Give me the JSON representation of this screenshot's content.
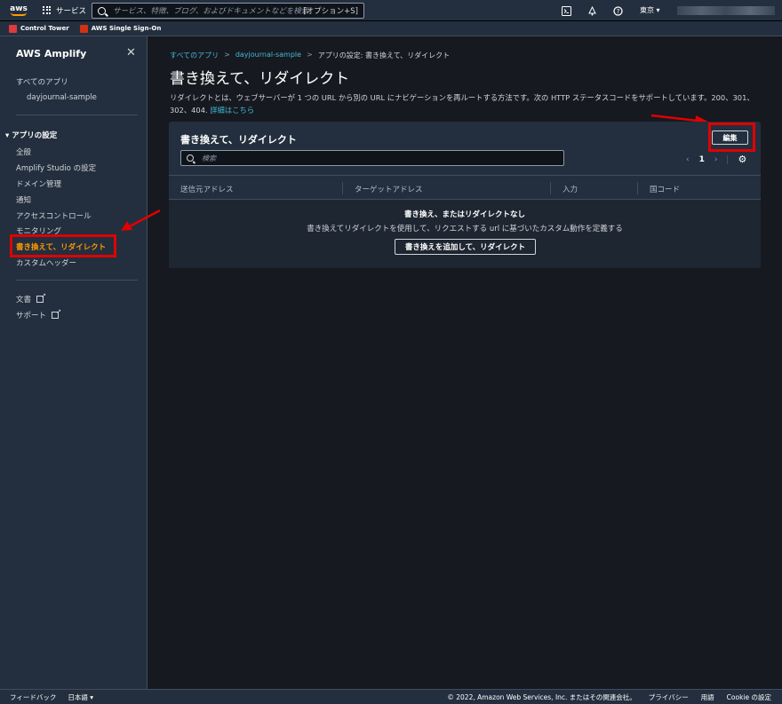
{
  "topnav": {
    "logo_text": "aws",
    "services_label": "サービス",
    "search_placeholder": "サービス、特徴、ブログ、およびドキュメントなどを検索",
    "search_shortcut": "[オプション+S]",
    "region": "東京 ▾",
    "icons": [
      "terminal-icon",
      "bell-icon",
      "help-icon"
    ]
  },
  "favorites": [
    {
      "label": "Control Tower",
      "color": "#e0393e"
    },
    {
      "label": "AWS Single Sign-On",
      "color": "#d13212"
    }
  ],
  "sidebar": {
    "title": "AWS Amplify",
    "close": "✕",
    "all_apps": "すべてのアプリ",
    "app_name": "dayjournal-sample",
    "section_title": "▾ アプリの設定",
    "items": [
      "全般",
      "Amplify Studio の設定",
      "ドメイン管理",
      "通知",
      "アクセスコントロール",
      "モニタリング",
      "書き換えて、リダイレクト",
      "カスタムヘッダー"
    ],
    "active_item": "書き換えて、リダイレクト",
    "links": [
      "文書",
      "サポート"
    ]
  },
  "breadcrumb": {
    "all_apps": "すべてのアプリ",
    "app": "dayjournal-sample",
    "current": "アプリの設定: 書き換えて、リダイレクト",
    "sep": ">"
  },
  "page": {
    "title": "書き換えて、リダイレクト",
    "description_line1": "リダイレクトとは、ウェブサーバーが 1 つの URL から別の URL にナビゲーションを再ルートする方法です。次の HTTP ステータスコードをサポートしています。200、301、",
    "description_line2": "302、404. ",
    "description_link": "詳細はこちら"
  },
  "panel": {
    "title": "書き換えて、リダイレクト",
    "edit_label": "編集",
    "filter_placeholder": "検索",
    "pager": {
      "prev": "‹",
      "page": "1",
      "next": "›",
      "settings": "⚙"
    },
    "columns": [
      "送信元アドレス",
      "ターゲットアドレス",
      "入力",
      "国コード"
    ],
    "empty_title": "書き換え、またはリダイレクトなし",
    "empty_sub": "書き換えてリダイレクトを使用して、リクエストする url に基づいたカスタム動作を定義する",
    "add_label": "書き換えを追加して、リダイレクト"
  },
  "footer": {
    "feedback": "フィードバック",
    "language": "日本語 ▾",
    "copyright": "© 2022, Amazon Web Services, Inc. またはその関連会社。",
    "privacy": "プライバシー",
    "terms": "用語",
    "cookie": "Cookie の設定"
  },
  "colors": {
    "accent": "#ff9900",
    "link": "#44b9d6",
    "annotation": "#e10000"
  }
}
